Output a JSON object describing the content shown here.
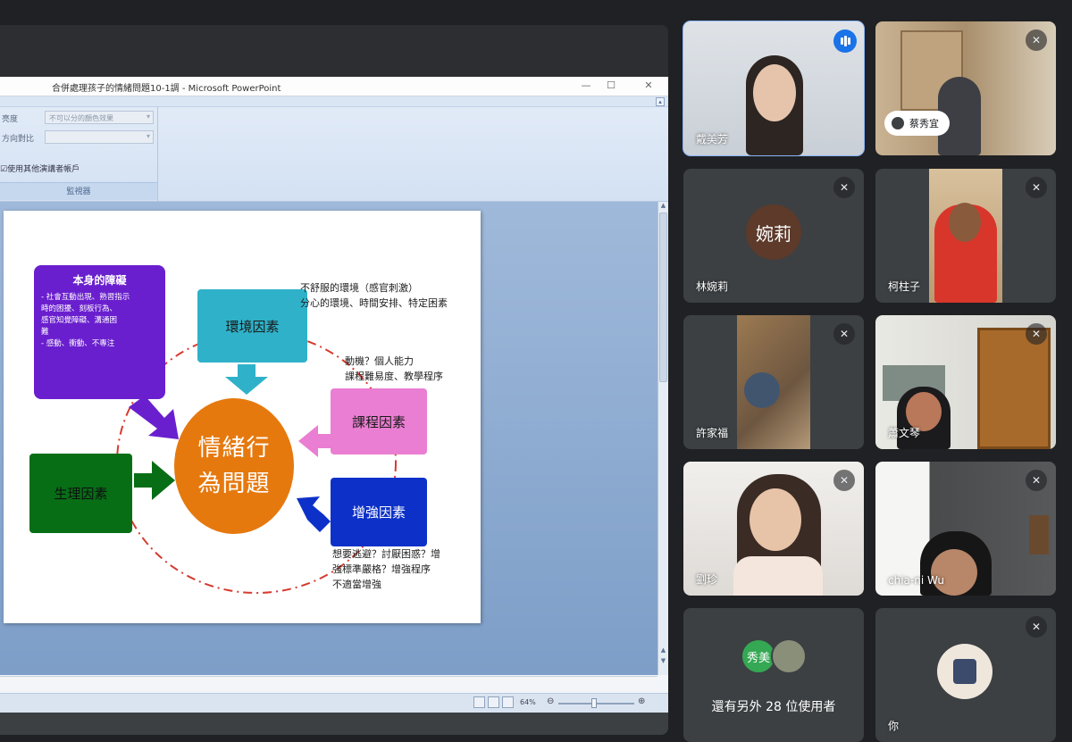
{
  "presentation": {
    "window_title": "合併處理孩子的情緒問題10-1調 - Microsoft PowerPoint",
    "window_controls": {
      "minimize": "—",
      "maximize": "☐",
      "close": "✕"
    },
    "ribbon": {
      "rows": [
        {
          "label": "亮度",
          "value": "不可以分的顏色效果"
        },
        {
          "label": "方向對比",
          "value": ""
        }
      ],
      "checkbox_label": "☑使用其他演講者帳戶",
      "group_label": "監視器"
    },
    "zoom_level": "64%",
    "slide": {
      "purple_title": "本身的障礙",
      "purple_lines": [
        "- 社會互動出現、熟習指示",
        "  時的困擾、刻板行為、",
        "  感官知覺障礙、溝通困",
        "  難",
        "- 感動、衝動、不專注"
      ],
      "teal_label": "環境因素",
      "pink_label": "課程因素",
      "green_label": "生理因素",
      "blue_label": "增強因素",
      "circle_lines": [
        "情緒行",
        "為問題"
      ],
      "note_env": [
        "不舒服的環境（感官刺激）",
        "分心的環境、時間安排、特定困素"
      ],
      "note_course": [
        "動機？個人能力",
        "課程難易度、教學程序"
      ],
      "note_reinforce": [
        "想要逃避？討厭困惑？增",
        "強標準嚴格？增強程序",
        "不適當增強"
      ]
    }
  },
  "participants": [
    {
      "name": "戴美芳",
      "status": "speaking"
    },
    {
      "name": "蔡秀宜",
      "status": "muted",
      "pill": true
    },
    {
      "name": "林婉莉",
      "status": "muted",
      "avatar_text": "婉莉",
      "avatar_color": "#5d3a2a"
    },
    {
      "name": "柯柱子",
      "status": "muted"
    },
    {
      "name": "許家福",
      "status": "muted"
    },
    {
      "name": "蕭文琴",
      "status": "muted"
    },
    {
      "name": "劉珍",
      "status": "muted"
    },
    {
      "name": "chia-ni Wu",
      "status": "muted"
    },
    {
      "name": "還有另外 28 位使用者",
      "status": "none",
      "avatar_text": "秀美",
      "avatar_color": "#34a853"
    },
    {
      "name": "你",
      "status": "muted"
    }
  ],
  "icons": {
    "mic_off": "mic-off-icon",
    "speaking": "audio-level-icon"
  },
  "colors": {
    "background": "#202124",
    "tile": "#3c4043",
    "accent": "#1a73e8",
    "active_border": "#8ab4f8"
  }
}
